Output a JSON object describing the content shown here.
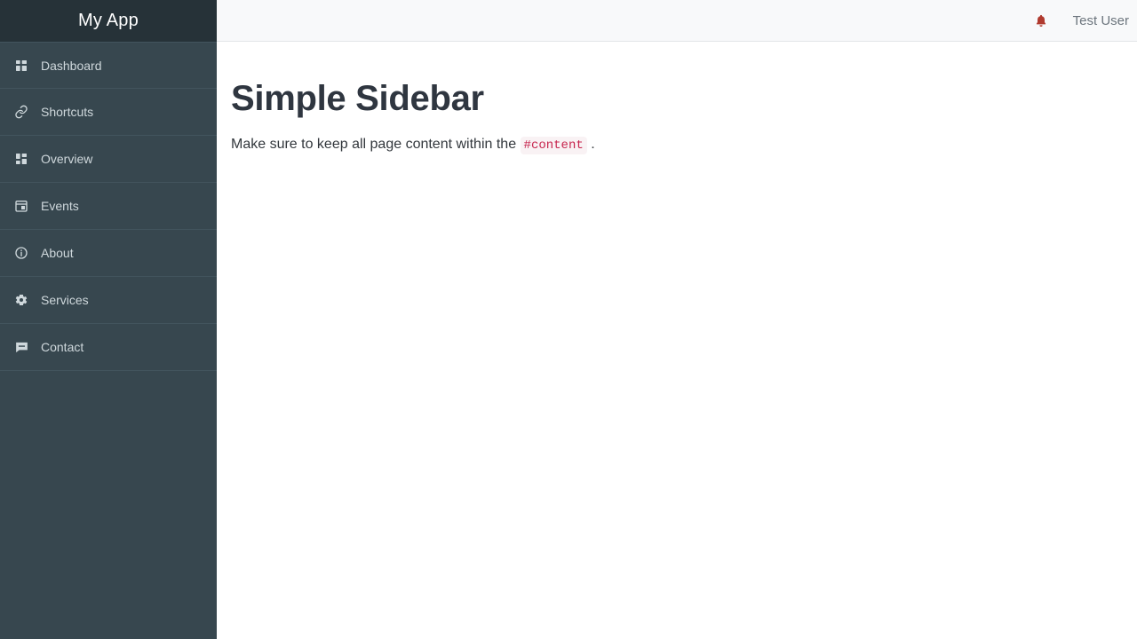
{
  "sidebar": {
    "brand": "My App",
    "items": [
      {
        "label": "Dashboard",
        "icon": "grid-icon"
      },
      {
        "label": "Shortcuts",
        "icon": "link-icon"
      },
      {
        "label": "Overview",
        "icon": "dashboard-icon"
      },
      {
        "label": "Events",
        "icon": "calendar-icon"
      },
      {
        "label": "About",
        "icon": "info-circle-icon"
      },
      {
        "label": "Services",
        "icon": "gear-icon"
      },
      {
        "label": "Contact",
        "icon": "chat-bubble-icon"
      }
    ]
  },
  "topbar": {
    "notification_icon": "bell-icon",
    "user_name": "Test User"
  },
  "main": {
    "title": "Simple Sidebar",
    "note_before": "Make sure to keep all page content within the",
    "note_code": "#content",
    "note_after": "."
  },
  "colors": {
    "sidebar_header_bg": "#263238",
    "sidebar_bg": "#37474f",
    "sidebar_divider": "#42545d",
    "sidebar_text": "#cfd8dc",
    "topbar_bg": "#f8f9fa",
    "topbar_border": "#e3e5e8",
    "user_text": "#6c757d",
    "bell": "#b03a2e",
    "title_text": "#2f3640",
    "code_text": "#c7254e",
    "code_bg": "#f9f2f4"
  }
}
